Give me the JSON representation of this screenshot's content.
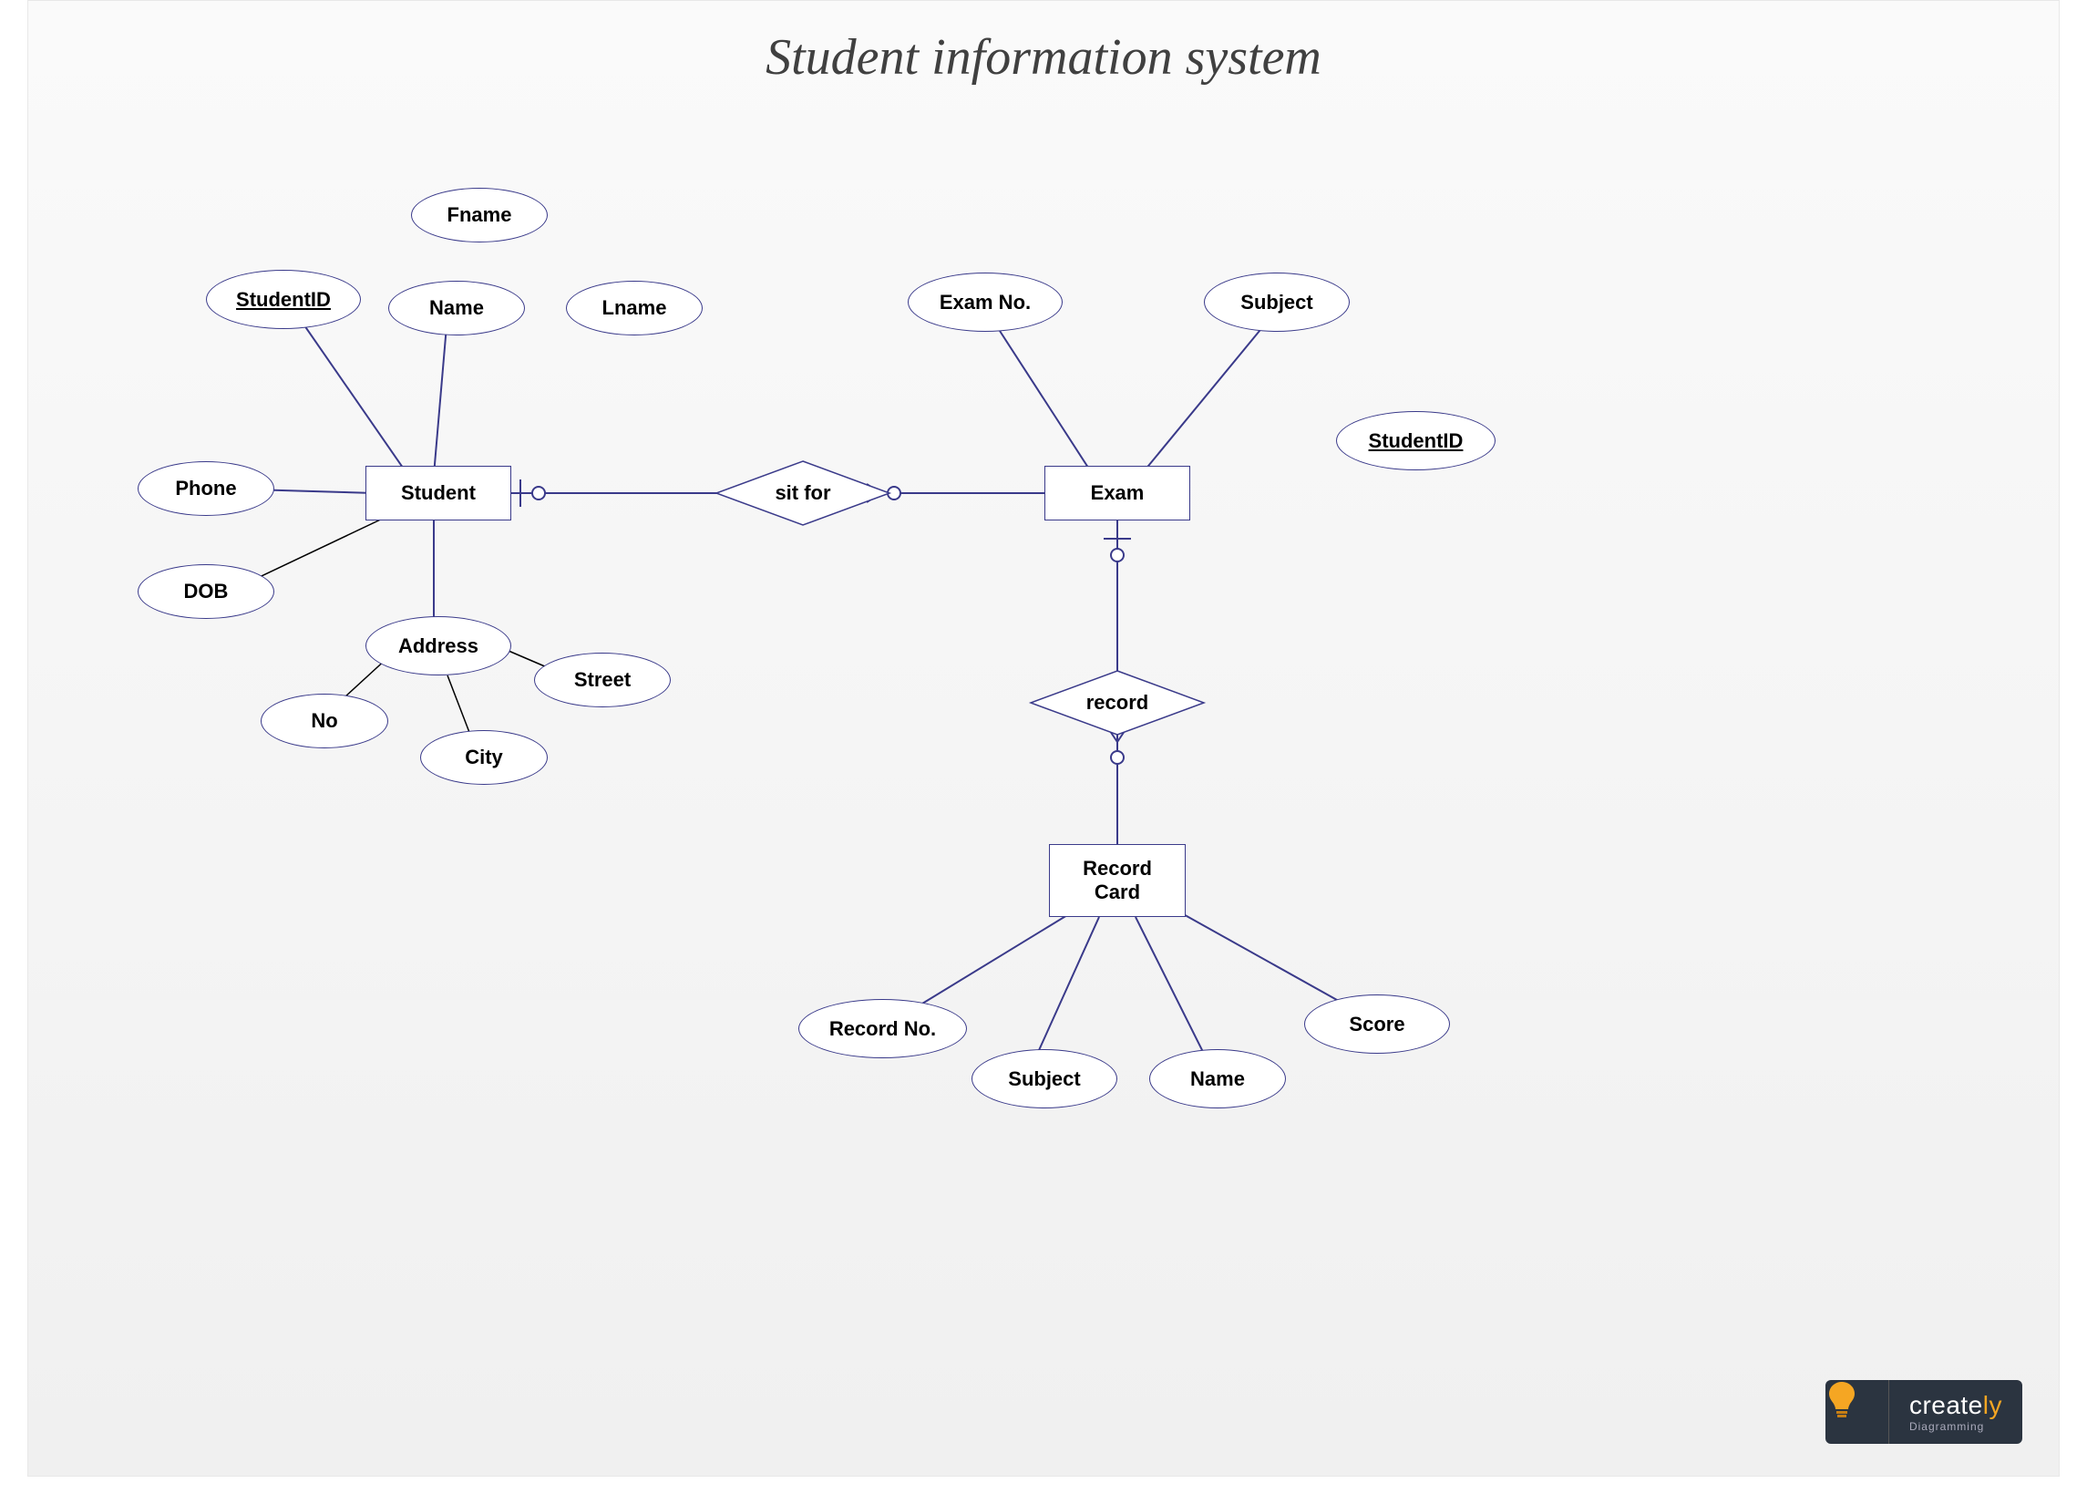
{
  "title": "Student information system",
  "entities": {
    "student": "Student",
    "exam": "Exam",
    "recordcard": "Record\nCard"
  },
  "relationships": {
    "sitfor": "sit for",
    "record": "record"
  },
  "attributes": {
    "studentid": "StudentID",
    "phone": "Phone",
    "dob": "DOB",
    "name": "Name",
    "fname": "Fname",
    "lname": "Lname",
    "address": "Address",
    "no": "No",
    "city": "City",
    "street": "Street",
    "examno": "Exam No.",
    "subject_exam": "Subject",
    "studentid_exam": "StudentID",
    "recordno": "Record No.",
    "subject_rc": "Subject",
    "name_rc": "Name",
    "score": "Score"
  },
  "logo": {
    "brand_a": "create",
    "brand_b": "ly",
    "tag": "Diagramming"
  }
}
